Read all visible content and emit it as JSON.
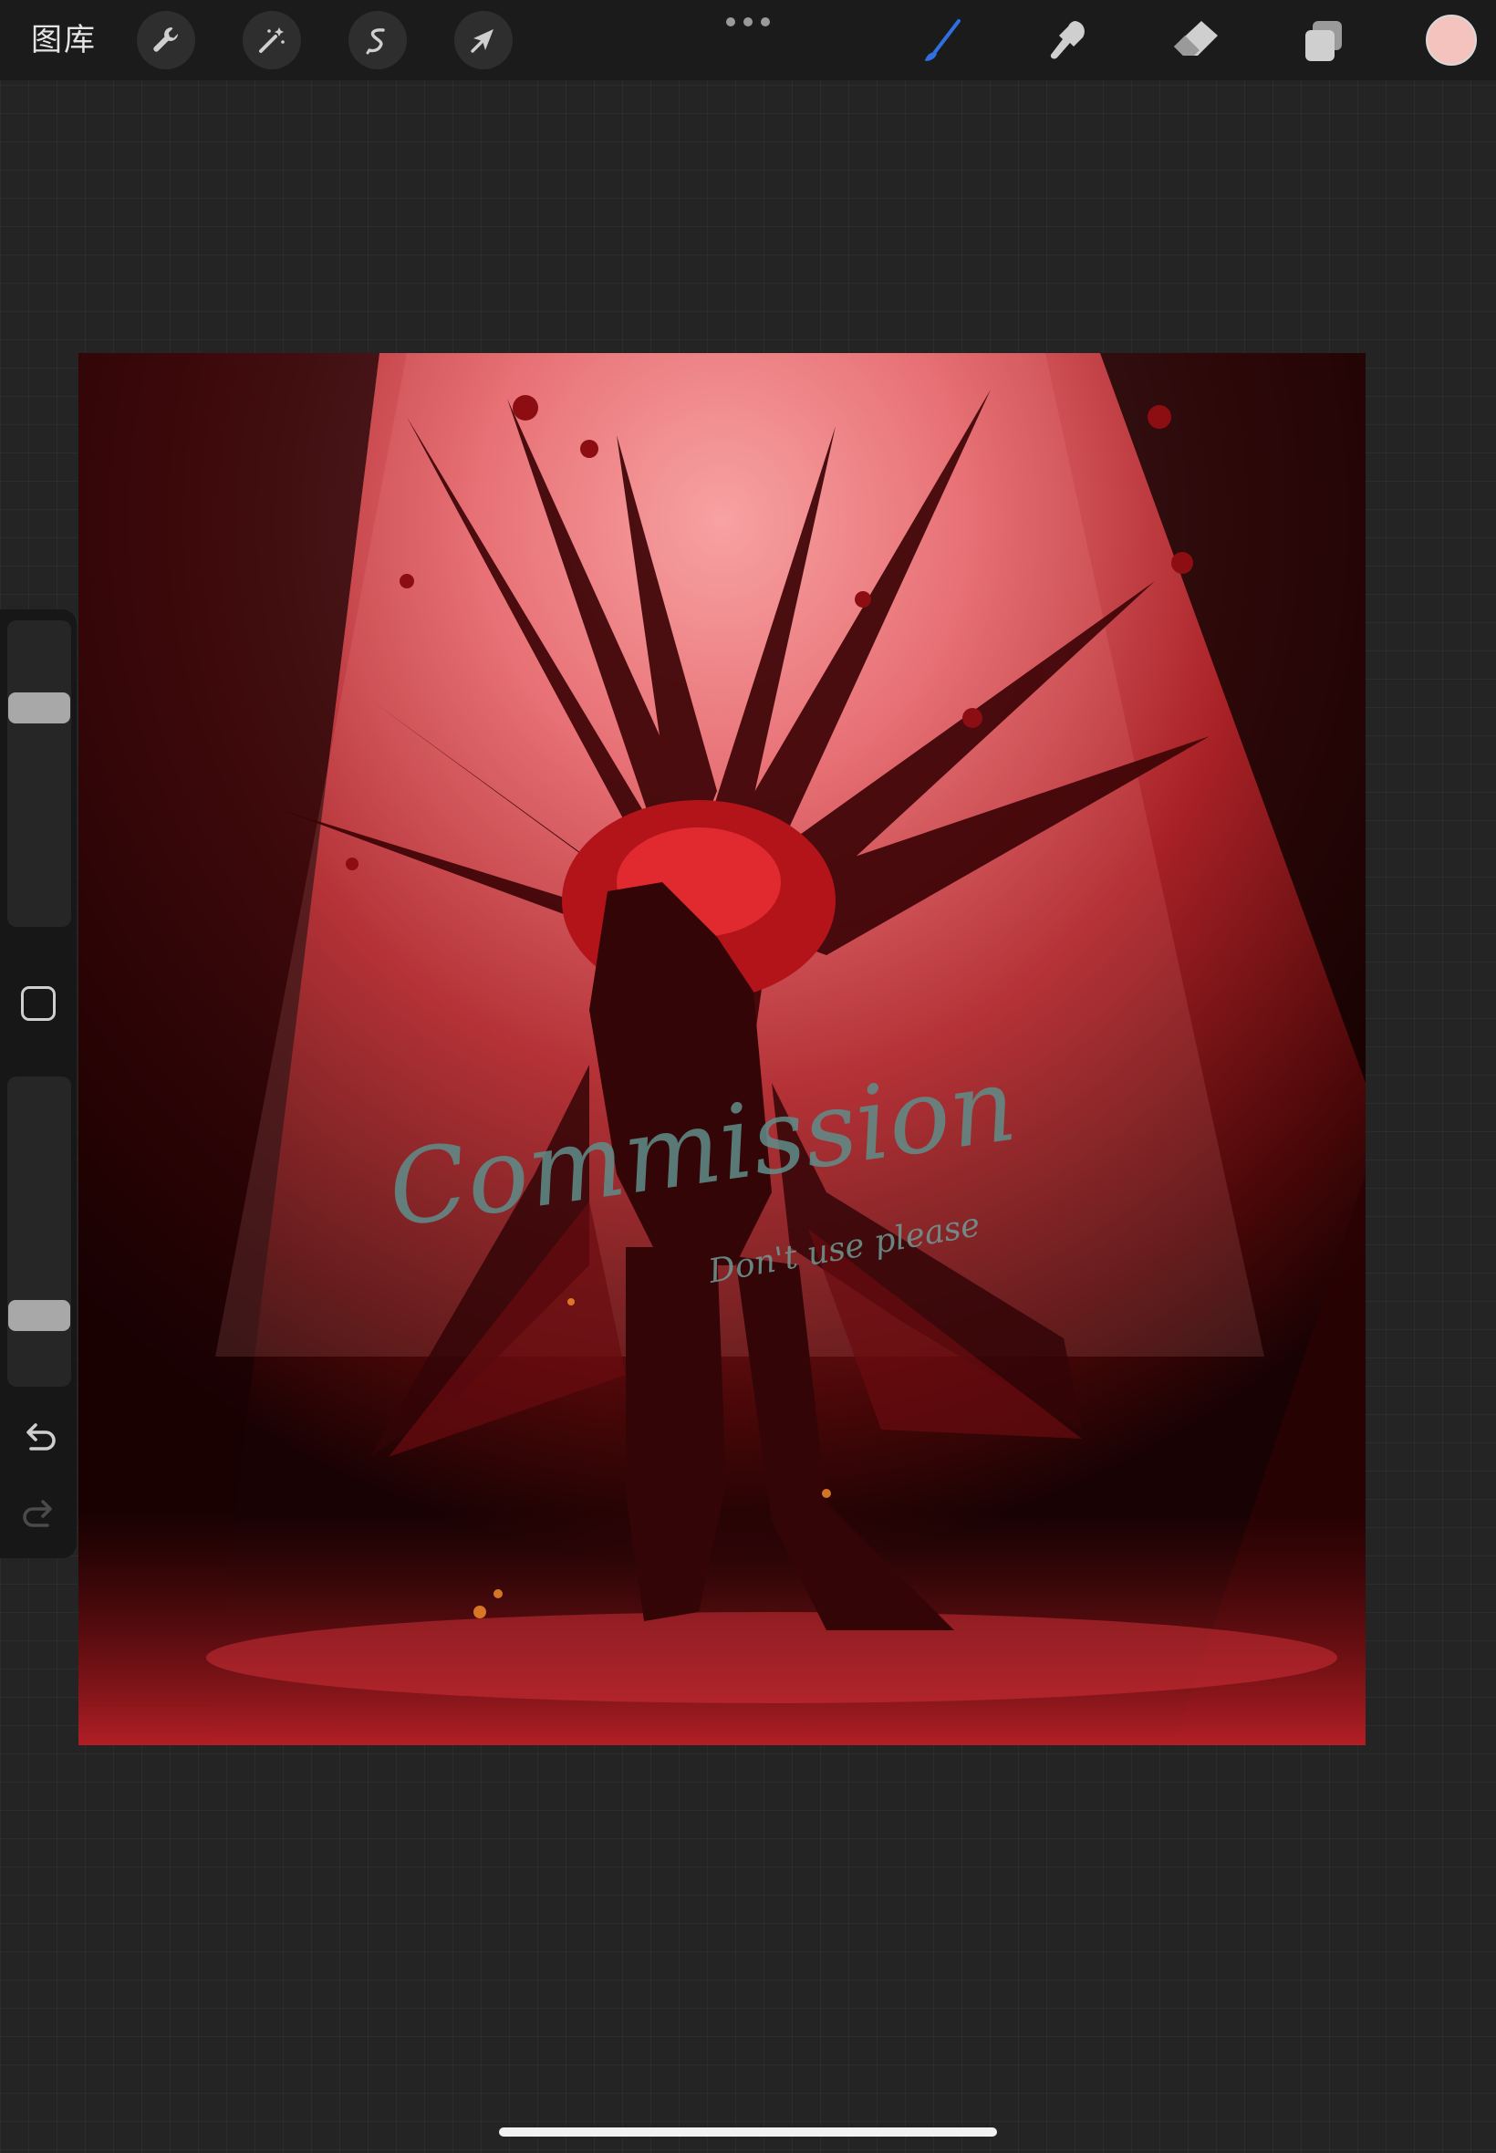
{
  "toolbar": {
    "gallery_label": "图库",
    "left_tools": [
      {
        "name": "actions",
        "icon": "wrench-icon"
      },
      {
        "name": "adjustments",
        "icon": "magic-wand-icon"
      },
      {
        "name": "selection",
        "icon": "selection-s-icon"
      },
      {
        "name": "transform",
        "icon": "arrow-cursor-icon"
      }
    ],
    "more_icon": "more-dots-icon",
    "right_tools": [
      {
        "name": "brush",
        "icon": "brush-icon",
        "active": true
      },
      {
        "name": "smudge",
        "icon": "smudge-finger-icon"
      },
      {
        "name": "eraser",
        "icon": "eraser-icon"
      },
      {
        "name": "layers",
        "icon": "layers-icon"
      }
    ],
    "current_color": "#f4c3bd"
  },
  "colors": {
    "toolbar_bg": "#1b1b1b",
    "canvas_bg": "#242424",
    "active_tool": "#2f6fe0",
    "icon_default": "#cfcfcf"
  },
  "sidebar": {
    "size_slider_value": 0.74,
    "opacity_slider_value": 0.2,
    "modify_icon": "square-modify-icon",
    "undo_icon": "undo-icon",
    "redo_icon": "redo-icon"
  },
  "artwork": {
    "watermark_text": "Commission",
    "watermark_subtext": "Don't use please"
  }
}
